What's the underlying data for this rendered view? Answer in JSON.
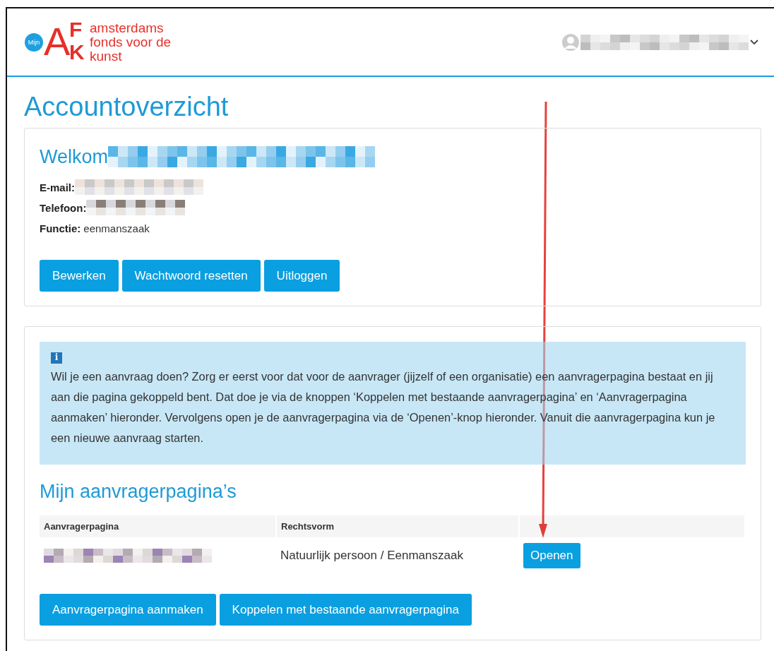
{
  "header": {
    "logo": {
      "badge": "Mijn",
      "letters": [
        "A",
        "F",
        "K"
      ],
      "lines": [
        "amsterdams",
        "fonds voor de",
        "kunst"
      ]
    }
  },
  "page_title": "Accountoverzicht",
  "account": {
    "greeting": "Welkom",
    "fields": [
      {
        "label": "E-mail:"
      },
      {
        "label": "Telefoon:"
      },
      {
        "label": "Functie:",
        "value": "eenmanszaak"
      }
    ],
    "buttons": [
      "Bewerken",
      "Wachtwoord resetten",
      "Uitloggen"
    ]
  },
  "info": {
    "icon": "i",
    "text": "Wil je een aanvraag doen? Zorg er eerst voor dat voor de aanvrager (jijzelf of een organisatie) een aanvragerpagina bestaat en jij aan die pagina gekoppeld bent. Dat doe je via de knoppen ‘Koppelen met bestaande aanvragerpagina’ en ‘Aanvragerpagina aanmaken’ hieronder. Vervolgens open je de aanvragerpagina via de ‘Openen’-knop hieronder. Vanuit die aanvragerpagina kun je een nieuwe aanvraag starten."
  },
  "pages": {
    "title": "Mijn aanvragerpagina’s",
    "table": {
      "columns": [
        "Aanvragerpagina",
        "Rechtsvorm"
      ],
      "rows": [
        {
          "rechtsvorm": "Natuurlijk persoon / Eenmanszaak",
          "button": "Openen"
        }
      ]
    },
    "buttons": [
      "Aanvragerpagina aanmaken",
      "Koppelen met bestaande aanvragerpagina"
    ]
  }
}
